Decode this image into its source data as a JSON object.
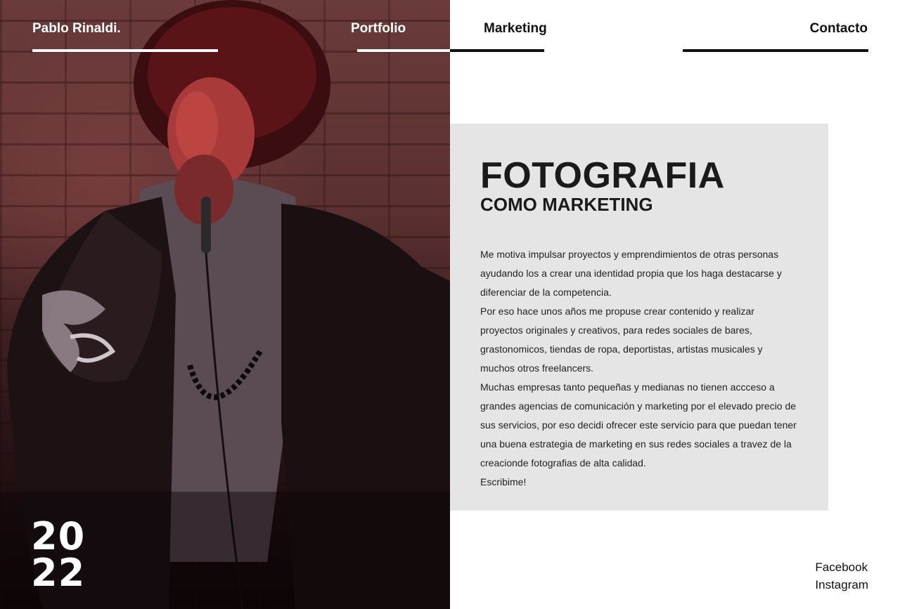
{
  "header": {
    "brand": "Pablo Rinaldi.",
    "nav": [
      {
        "label": "Portfolio"
      },
      {
        "label": "Marketing"
      },
      {
        "label": "Contacto"
      }
    ]
  },
  "hero": {
    "year_top": "20",
    "year_bottom": "22"
  },
  "content": {
    "title": "FOTOGRAFIA",
    "subtitle": "COMO MARKETING",
    "paragraphs": [
      "Me motiva impulsar proyectos y emprendimientos de otras personas ayudando los a crear una identidad propia que los haga destacarse y diferenciar de la competencia.",
      "Por eso hace unos años me propuse crear contenido y realizar proyectos originales  y creativos, para redes sociales de bares, grastonomicos, tiendas de ropa, deportistas, artistas musicales y muchos otros freelancers.",
      "Muchas empresas tanto pequeñas y medianas no tienen accceso a grandes agencias de comunicación y marketing por el elevado precio de sus servicios, por eso decidi ofrecer este servicio para que puedan tener una buena estrategia de marketing en sus redes sociales a travez de la creacionde fotografias de alta calidad.",
      "Escribime!"
    ]
  },
  "social": {
    "facebook": "Facebook",
    "instagram": "Instagram"
  },
  "colors": {
    "card_bg": "#e5e5e5",
    "text_dark": "#1a1a1a",
    "photo_red": "#8c1e23"
  }
}
